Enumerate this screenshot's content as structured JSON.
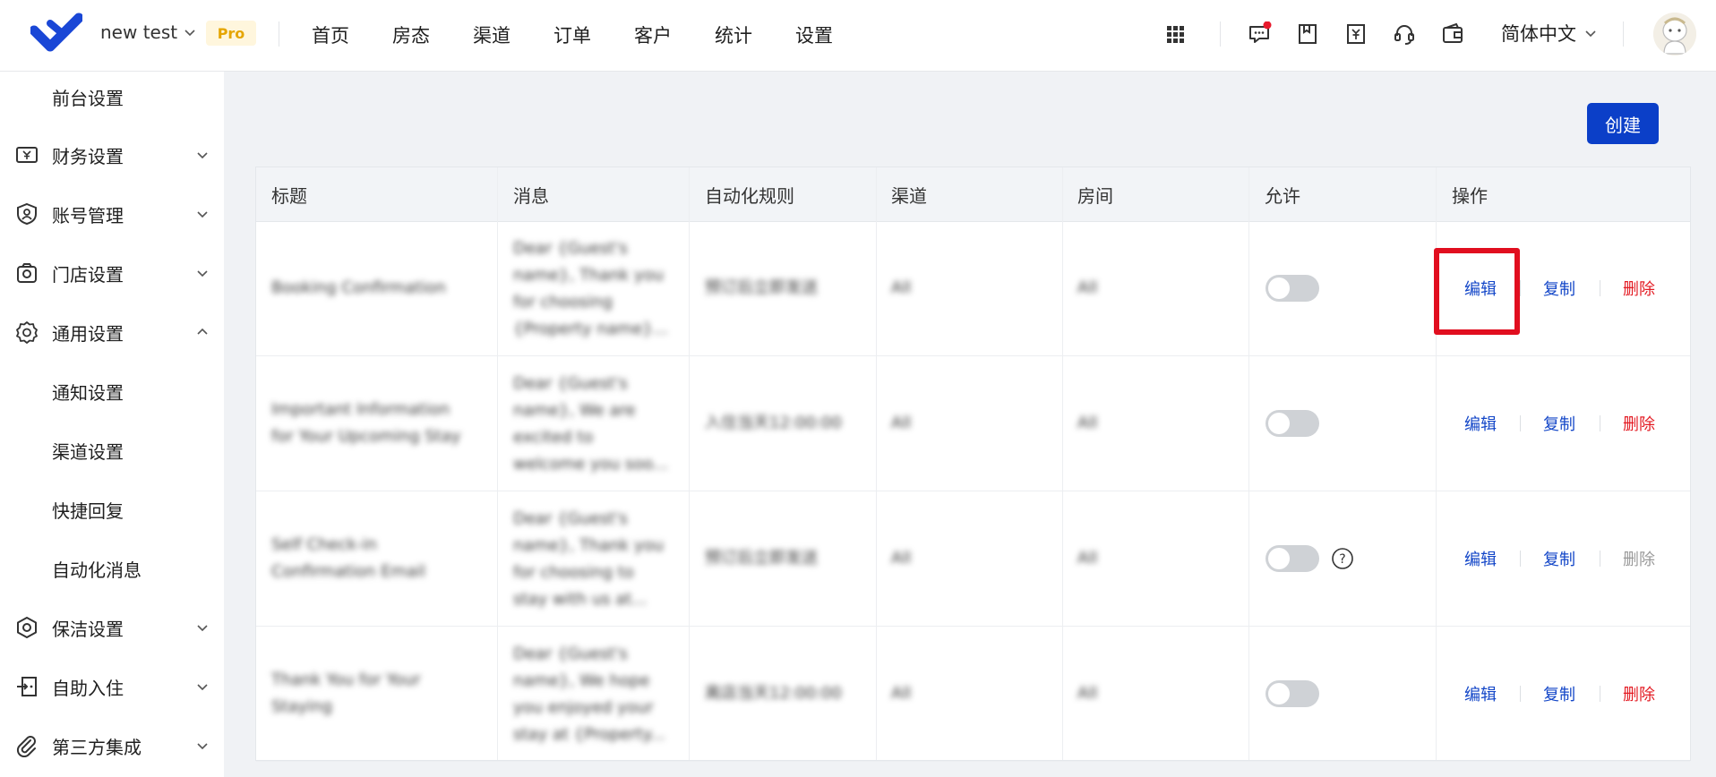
{
  "header": {
    "workspace_name": "new test",
    "badge": "Pro",
    "nav": [
      "首页",
      "房态",
      "渠道",
      "订单",
      "客户",
      "统计",
      "设置"
    ],
    "language": "简体中文"
  },
  "sidebar": {
    "items": [
      {
        "label": "前台设置",
        "icon": "none",
        "expandable": false
      },
      {
        "label": "财务设置",
        "icon": "finance-icon",
        "expandable": true,
        "expanded": false
      },
      {
        "label": "账号管理",
        "icon": "account-icon",
        "expandable": true,
        "expanded": false
      },
      {
        "label": "门店设置",
        "icon": "store-icon",
        "expandable": true,
        "expanded": false
      },
      {
        "label": "通用设置",
        "icon": "gear-icon",
        "expandable": true,
        "expanded": true
      },
      {
        "label": "通知设置",
        "icon": "none",
        "expandable": false
      },
      {
        "label": "渠道设置",
        "icon": "none",
        "expandable": false
      },
      {
        "label": "快捷回复",
        "icon": "none",
        "expandable": false
      },
      {
        "label": "自动化消息",
        "icon": "none",
        "expandable": false
      },
      {
        "label": "保洁设置",
        "icon": "cleaning-icon",
        "expandable": true,
        "expanded": false
      },
      {
        "label": "自助入住",
        "icon": "checkin-icon",
        "expandable": true,
        "expanded": false
      },
      {
        "label": "第三方集成",
        "icon": "paperclip-icon",
        "expandable": true,
        "expanded": false
      }
    ]
  },
  "toolbar": {
    "create_label": "创建"
  },
  "table": {
    "columns": [
      "标题",
      "消息",
      "自动化规则",
      "渠道",
      "房间",
      "允许",
      "操作"
    ],
    "rows": [
      {
        "title": [
          "Booking Confirmation"
        ],
        "message": [
          "Dear {Guest's",
          "name}, Thank you",
          "for choosing",
          "{Property name}..."
        ],
        "rule": "预订后立即发送",
        "channel": "All",
        "room": "All",
        "enabled": false,
        "help": false,
        "delete_enabled": true
      },
      {
        "title": [
          "Important Information",
          "for Your Upcoming Stay"
        ],
        "message": [
          "Dear {Guest's",
          "name}, We are",
          "excited to",
          "welcome you soo..."
        ],
        "rule": "入住当天12:00:00",
        "channel": "All",
        "room": "All",
        "enabled": false,
        "help": false,
        "delete_enabled": true
      },
      {
        "title": [
          "Self Check-in",
          "Confirmation Email"
        ],
        "message": [
          "Dear {Guest's",
          "name}, Thank you",
          "for choosing to",
          "stay with us at..."
        ],
        "rule": "预订后立即发送",
        "channel": "All",
        "room": "All",
        "enabled": false,
        "help": true,
        "delete_enabled": false
      },
      {
        "title": [
          "Thank You for Your",
          "Staying"
        ],
        "message": [
          "Dear {Guest's",
          "name}, We hope",
          "you enjoyed your",
          "stay at {Property..."
        ],
        "rule": "离店当天12:00:00",
        "channel": "All",
        "room": "All",
        "enabled": false,
        "help": false,
        "delete_enabled": true
      }
    ],
    "actions": {
      "edit": "编辑",
      "copy": "复制",
      "delete": "删除"
    }
  },
  "colors": {
    "primary": "#0b3fc8",
    "link": "#1447c8",
    "danger": "#e31b23",
    "highlight": "#e10e1f",
    "notification_dot": "#e8192c"
  }
}
